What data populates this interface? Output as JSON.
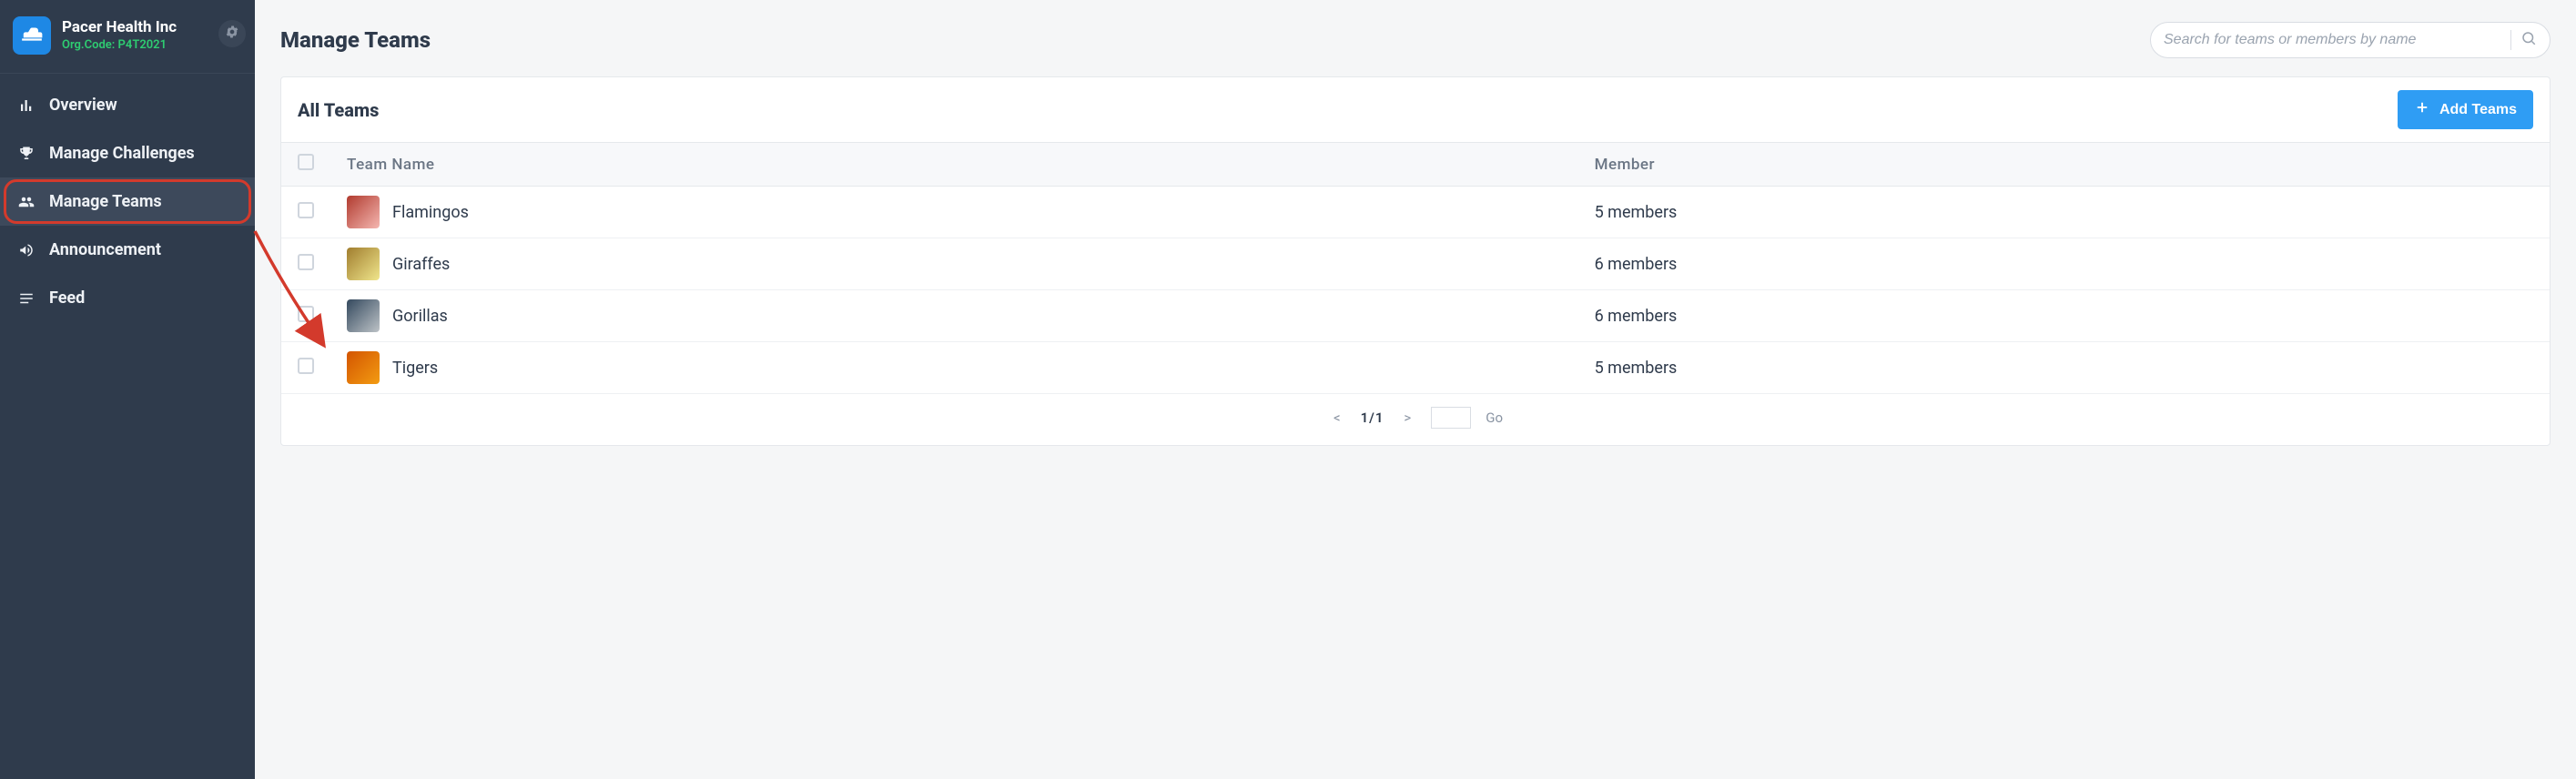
{
  "org": {
    "name": "Pacer Health Inc",
    "code_label": "Org.Code: P4T2021"
  },
  "sidebar": {
    "items": [
      {
        "icon": "bar-chart-icon",
        "label": "Overview"
      },
      {
        "icon": "trophy-icon",
        "label": "Manage Challenges"
      },
      {
        "icon": "users-icon",
        "label": "Manage Teams",
        "active": true,
        "highlight": true
      },
      {
        "icon": "megaphone-icon",
        "label": "Announcement"
      },
      {
        "icon": "feed-icon",
        "label": "Feed"
      }
    ]
  },
  "page": {
    "title": "Manage Teams"
  },
  "search": {
    "placeholder": "Search for teams or members by name"
  },
  "card": {
    "title": "All Teams",
    "add_label": "Add Teams"
  },
  "table": {
    "columns": {
      "name": "Team Name",
      "member": "Member"
    },
    "rows": [
      {
        "avatar": "av-flamingo",
        "name": "Flamingos",
        "members": "5 members"
      },
      {
        "avatar": "av-giraffe",
        "name": "Giraffes",
        "members": "6 members"
      },
      {
        "avatar": "av-gorilla",
        "name": "Gorillas",
        "members": "6 members"
      },
      {
        "avatar": "av-tiger",
        "name": "Tigers",
        "members": "5 members"
      }
    ]
  },
  "pager": {
    "prev": "<",
    "position": "1/1",
    "next": ">",
    "go": "Go"
  }
}
